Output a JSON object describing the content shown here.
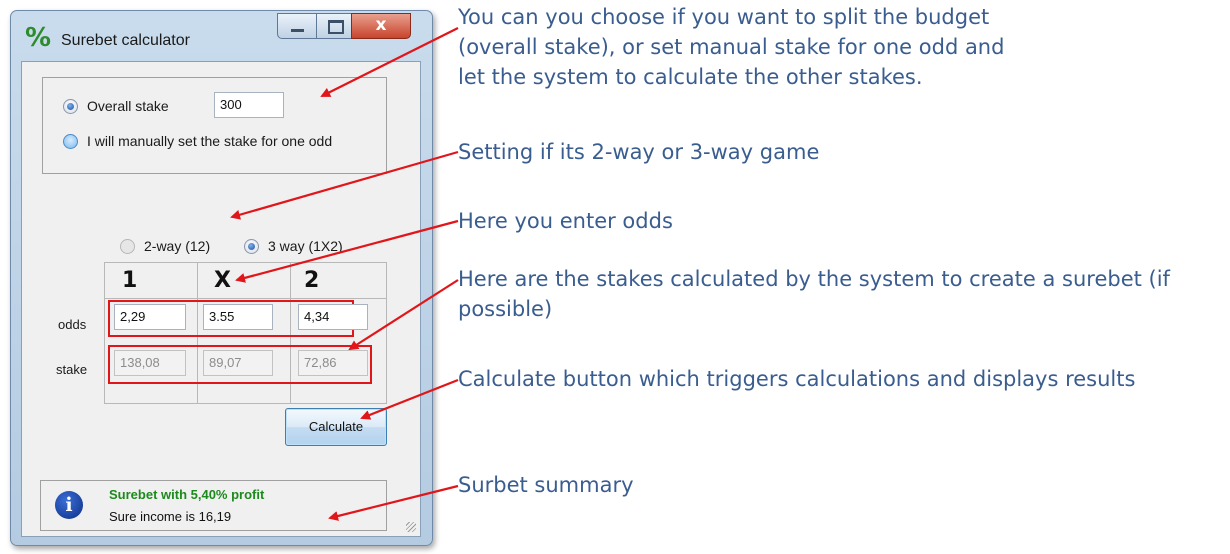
{
  "window": {
    "title": "Surebet calculator",
    "app_icon_glyph": "%",
    "close_glyph": "x"
  },
  "stake_mode": {
    "overall_label": "Overall stake",
    "overall_value": "300",
    "manual_label": "I will manually set the stake for one odd",
    "selected": "overall"
  },
  "game_type": {
    "two_way_label": "2-way (12)",
    "three_way_label": "3 way (1X2)",
    "selected": "3-way"
  },
  "table": {
    "headers": [
      "1",
      "X",
      "2"
    ],
    "odds_label": "odds",
    "stake_label": "stake",
    "odds": [
      "2,29",
      "3.55",
      "4,34"
    ],
    "stakes": [
      "138,08",
      "89,07",
      "72,86"
    ]
  },
  "calculate_button": "Calculate",
  "summary": {
    "headline": "Surebet with 5,40% profit",
    "income": "Sure income is  16,19"
  },
  "annotations": {
    "stake_mode": "You can you choose if you want to split the budget (overall stake), or set manual stake for one odd and let the system to calculate the other stakes.",
    "game_type": "Setting if its 2-way or 3-way game",
    "odds": "Here you enter odds",
    "stakes": "Here are the stakes calculated by the system to create a surebet (if possible)",
    "calculate": "Calculate button which triggers calculations and displays results",
    "summary": "Surbet summary"
  },
  "colors": {
    "annotation_text": "#3a5d8f",
    "arrow": "#e0161a",
    "highlight_box": "#e0161a",
    "profit_text": "#1d8a1d"
  },
  "icons": [
    "percent-icon",
    "minimize-icon",
    "maximize-icon",
    "close-icon",
    "info-icon"
  ]
}
